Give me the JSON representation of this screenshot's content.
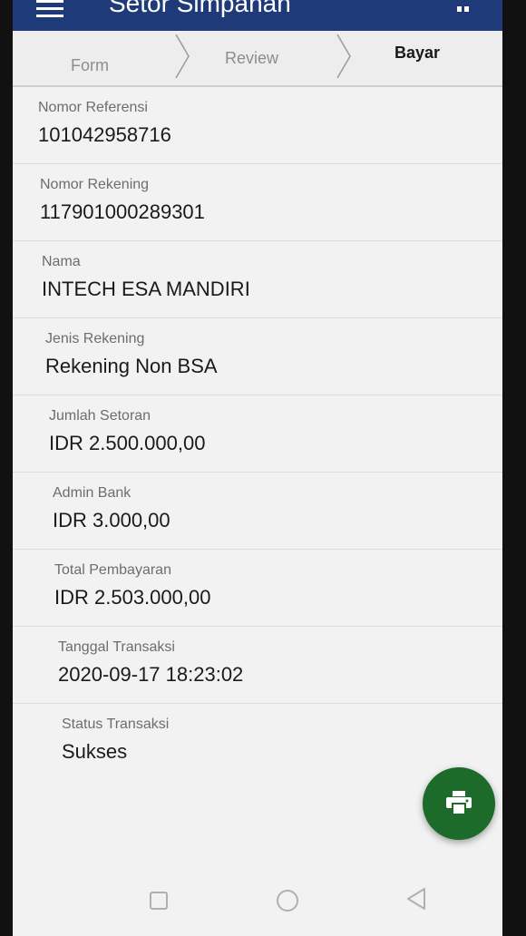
{
  "app": {
    "title": "Setor Simpanan",
    "accent_color": "#1e3a78",
    "menu_icon": "hamburger-menu-icon",
    "more_icon": "more-icon"
  },
  "stepper": {
    "steps": [
      "Form",
      "Review",
      "Bayar"
    ],
    "active_step": "Bayar"
  },
  "fields": [
    {
      "label": "Nomor Referensi",
      "value": "101042958716"
    },
    {
      "label": "Nomor Rekening",
      "value": "117901000289301"
    },
    {
      "label": "Nama",
      "value": "INTECH ESA MANDIRI"
    },
    {
      "label": "Jenis Rekening",
      "value": "Rekening Non BSA"
    },
    {
      "label": "Jumlah Setoran",
      "value": "IDR 2.500.000,00"
    },
    {
      "label": "Admin Bank",
      "value": "IDR 3.000,00"
    },
    {
      "label": "Total Pembayaran",
      "value": "IDR 2.503.000,00"
    },
    {
      "label": "Tanggal Transaksi",
      "value": "2020-09-17 18:23:02"
    },
    {
      "label": "Status Transaksi",
      "value": "Sukses"
    }
  ],
  "fab": {
    "icon": "print-icon",
    "color": "#1c6b2a"
  },
  "system_nav": {
    "icons": [
      "recent-apps-icon",
      "home-icon",
      "back-icon"
    ]
  }
}
